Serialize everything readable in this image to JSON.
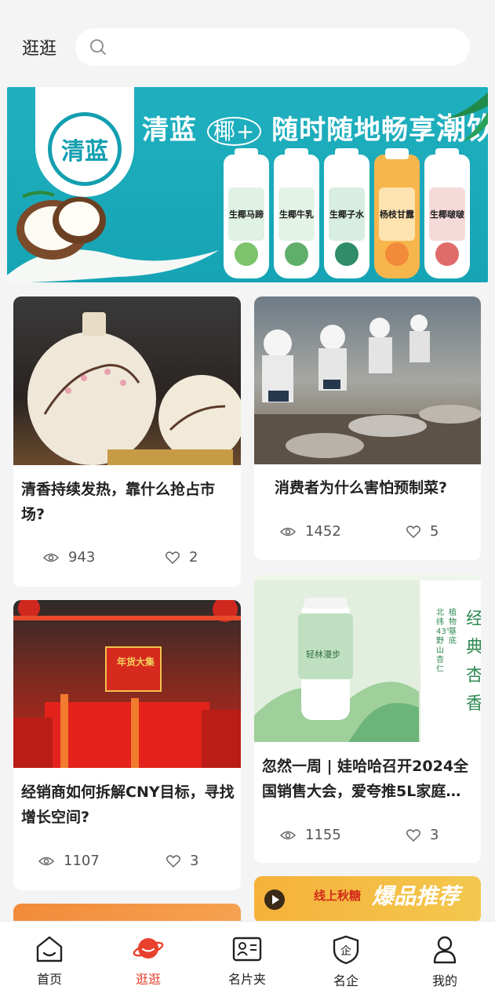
{
  "header": {
    "title": "逛逛",
    "search_placeholder": ""
  },
  "banner": {
    "brand": "清蓝",
    "slogan_part1": "清蓝",
    "slogan_logo": "椰+",
    "slogan_part2": "随时随地畅享",
    "slogan_strong": "潮饮",
    "bottles": [
      {
        "label": "生椰马蹄",
        "color": "#4fb06a"
      },
      {
        "label": "生椰牛乳",
        "color": "#4aa86a"
      },
      {
        "label": "生椰子水",
        "color": "#2f8d6a"
      },
      {
        "label": "杨枝甘露",
        "color": "#f0a43a"
      },
      {
        "label": "生椰啵啵",
        "color": "#e06b6b"
      }
    ]
  },
  "feed": {
    "left": [
      {
        "title": "清香持续发热，靠什么抢占市场?",
        "views": "943",
        "likes": "2"
      },
      {
        "title": "经销商如何拆解CNY目标，寻找增长空间?",
        "views": "1107",
        "likes": "3"
      }
    ],
    "right": [
      {
        "title": "消费者为什么害怕预制菜?",
        "views": "1452",
        "likes": "5"
      },
      {
        "title": "忽然一周 | 娃哈哈召开2024全国销售大会，爱夸推5L家庭…",
        "views": "1155",
        "likes": "3"
      }
    ],
    "ad_card": {
      "badge": "线上秋糖",
      "headline": "爆品推荐"
    },
    "product_card": {
      "bottle_label": "轻林漫步",
      "side_text": "经典杏香",
      "vertical_text": "植物基底",
      "vertical_text2": "北纬43°野山杏仁"
    },
    "cny_sign": "年货大集"
  },
  "nav": {
    "items": [
      {
        "label": "首页",
        "icon": "home-icon"
      },
      {
        "label": "逛逛",
        "icon": "planet-icon",
        "active": true
      },
      {
        "label": "名片夹",
        "icon": "card-holder-icon"
      },
      {
        "label": "名企",
        "icon": "enterprise-shield-icon"
      },
      {
        "label": "我的",
        "icon": "profile-icon"
      }
    ],
    "active_color": "#e8412c"
  }
}
